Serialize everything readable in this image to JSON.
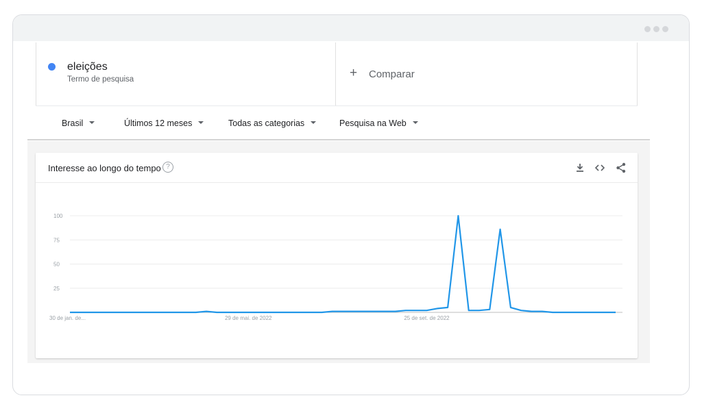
{
  "search": {
    "term": "eleições",
    "term_type": "Termo de pesquisa",
    "term_color": "#4285f4",
    "compare_label": "Comparar"
  },
  "filters": [
    "Brasil",
    "Últimos 12 meses",
    "Todas as categorias",
    "Pesquisa na Web"
  ],
  "card": {
    "title": "Interesse ao longo do tempo",
    "icons": [
      "help-icon",
      "download-icon",
      "embed-icon",
      "share-icon"
    ]
  },
  "chart_data": {
    "type": "line",
    "title": "",
    "xlabel": "",
    "ylabel": "",
    "ylim": [
      0,
      100
    ],
    "yticks": [
      25,
      50,
      75,
      100
    ],
    "x_tick_labels": [
      "30 de jan. de...",
      "29 de mai. de 2022",
      "25 de set. de 2022"
    ],
    "grid": true,
    "line_color": "#2196e8",
    "series": [
      {
        "values": [
          0,
          0,
          0,
          0,
          0,
          0,
          0,
          0,
          0,
          0,
          0,
          0,
          0,
          1,
          0,
          0,
          0,
          0,
          0,
          0,
          0,
          0,
          0,
          0,
          0,
          1,
          1,
          1,
          1,
          1,
          1,
          1,
          2,
          2,
          2,
          4,
          5,
          100,
          2,
          2,
          3,
          86,
          5,
          2,
          1,
          1,
          0,
          0,
          0,
          0,
          0,
          0,
          0
        ]
      }
    ]
  }
}
